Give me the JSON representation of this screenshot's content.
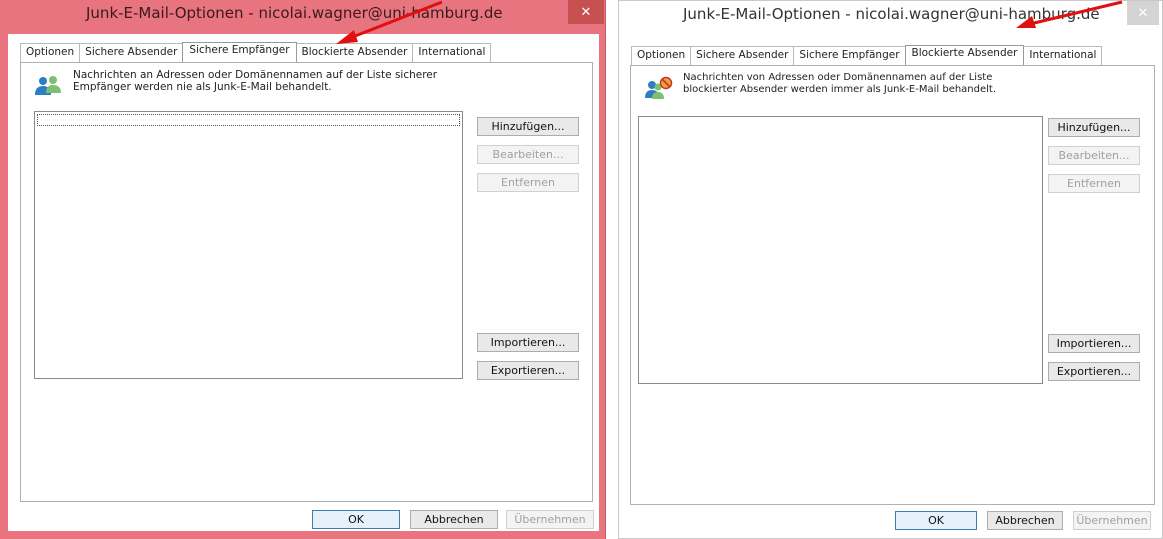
{
  "windows": [
    {
      "title": "Junk-E-Mail-Optionen - nicolai.wagner@uni-hamburg.de",
      "close_glyph": "✕",
      "tabs": [
        "Optionen",
        "Sichere Absender",
        "Sichere Empfänger",
        "Blockierte Absender",
        "International"
      ],
      "active_tab": "Sichere Empfänger",
      "info_line1": "Nachrichten an Adressen oder Domänennamen auf der Liste sicherer",
      "info_line2": "Empfänger werden nie als Junk-E-Mail behandelt.",
      "icon": "people-icon",
      "buttons": {
        "add": "Hinzufügen...",
        "edit": "Bearbeiten...",
        "remove": "Entfernen",
        "import": "Importieren...",
        "export": "Exportieren..."
      },
      "footer": {
        "ok": "OK",
        "cancel": "Abbrechen",
        "apply": "Übernehmen"
      },
      "frame_color": "#e8747f"
    },
    {
      "title": "Junk-E-Mail-Optionen - nicolai.wagner@uni-hamburg.de",
      "close_glyph": "✕",
      "tabs": [
        "Optionen",
        "Sichere Absender",
        "Sichere Empfänger",
        "Blockierte Absender",
        "International"
      ],
      "active_tab": "Blockierte Absender",
      "info_line1": "Nachrichten von Adressen oder Domänennamen auf der Liste",
      "info_line2": "blockierter Absender werden immer als Junk-E-Mail behandelt.",
      "icon": "blocked-sender-icon",
      "buttons": {
        "add": "Hinzufügen...",
        "edit": "Bearbeiten...",
        "remove": "Entfernen",
        "import": "Importieren...",
        "export": "Exportieren..."
      },
      "footer": {
        "ok": "OK",
        "cancel": "Abbrechen",
        "apply": "Übernehmen"
      },
      "frame_color": "#ffffff"
    }
  ],
  "annotation": {
    "arrow_color": "#e01010",
    "icon": "red-arrow-icon"
  }
}
